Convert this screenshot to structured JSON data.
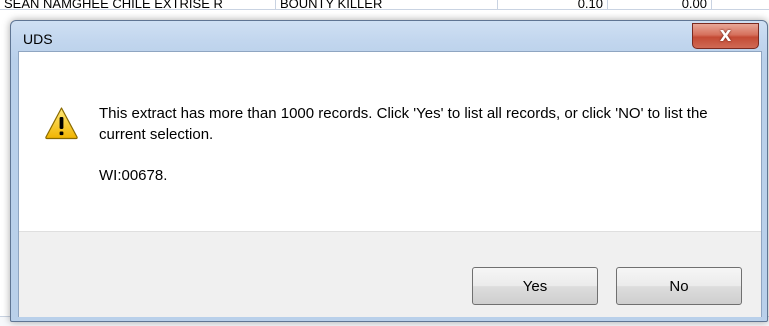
{
  "background_sheet": {
    "top_row": [
      "SEAN NAMGHEE CHILE EXTRISE R",
      "BOUNTY KILLER",
      "0.10",
      "0.00"
    ]
  },
  "dialog": {
    "title": "UDS",
    "close_label": "X",
    "message": "This extract has more than 1000 records. Click 'Yes' to list all records, or click 'NO' to list the current selection.",
    "code": "WI:00678.",
    "icon": "warning-icon",
    "buttons": {
      "yes": "Yes",
      "no": "No"
    }
  },
  "colors": {
    "title_bar": "#c2d6ee",
    "close_button": "#c44a34",
    "footer": "#f0f0f0",
    "warning_yellow": "#f5c400"
  }
}
